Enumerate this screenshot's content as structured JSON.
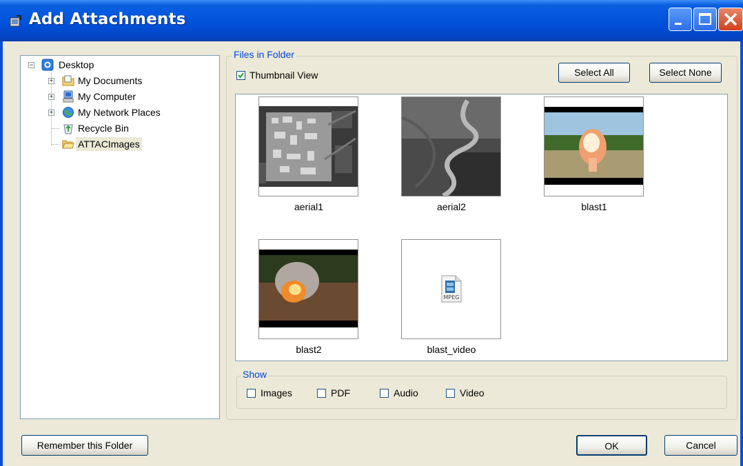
{
  "window": {
    "title": "Add Attachments"
  },
  "tree": {
    "items": [
      {
        "label": "Desktop",
        "icon": "desktop-icon",
        "expander": "−"
      },
      {
        "label": "My Documents",
        "icon": "my-documents-icon",
        "expander": "+"
      },
      {
        "label": "My Computer",
        "icon": "my-computer-icon",
        "expander": "+"
      },
      {
        "label": "My Network Places",
        "icon": "network-places-icon",
        "expander": "+"
      },
      {
        "label": "Recycle Bin",
        "icon": "recycle-bin-icon"
      },
      {
        "label": "ATTACImages",
        "icon": "folder-icon",
        "selected": true
      }
    ]
  },
  "files": {
    "group_title": "Files in Folder",
    "thumbnail_view_label": "Thumbnail View",
    "thumbnail_view_checked": true,
    "select_all_label": "Select All",
    "select_none_label": "Select None",
    "items": [
      {
        "name": "aerial1",
        "kind": "image"
      },
      {
        "name": "aerial2",
        "kind": "image"
      },
      {
        "name": "blast1",
        "kind": "image"
      },
      {
        "name": "blast2",
        "kind": "image"
      },
      {
        "name": "blast_video",
        "kind": "video",
        "badge": "MPEG"
      }
    ]
  },
  "show": {
    "group_title": "Show",
    "filters": [
      {
        "label": "Images",
        "checked": false
      },
      {
        "label": "PDF",
        "checked": false
      },
      {
        "label": "Audio",
        "checked": false
      },
      {
        "label": "Video",
        "checked": false
      }
    ]
  },
  "footer": {
    "remember_label": "Remember this Folder",
    "ok_label": "OK",
    "cancel_label": "Cancel"
  },
  "colors": {
    "titlebar": "#0154dc",
    "group_title": "#0046d5",
    "dialog_bg": "#ece9d8"
  }
}
